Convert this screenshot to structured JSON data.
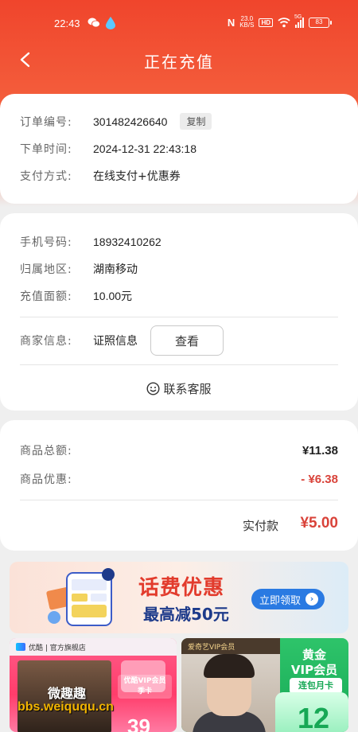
{
  "status_bar": {
    "time": "22:43",
    "network_speed_value": "23.0",
    "network_speed_unit": "KB/S",
    "hd": "HD",
    "signal": "5G",
    "battery": "83"
  },
  "nav": {
    "title": "正在充值"
  },
  "order": {
    "number_label": "订单编号:",
    "number_value": "301482426640",
    "copy_label": "复制",
    "time_label": "下单时间:",
    "time_value": "2024-12-31 22:43:18",
    "pay_method_label": "支付方式:",
    "pay_method_value": "在线支付+优惠券"
  },
  "recharge": {
    "phone_label": "手机号码:",
    "phone_value": "18932410262",
    "region_label": "归属地区:",
    "region_value": "湖南移动",
    "face_label": "充值面额:",
    "face_value": "10.00元",
    "merchant_label": "商家信息:",
    "merchant_value": "证照信息",
    "view_button": "查看",
    "service_label": "联系客服"
  },
  "summary": {
    "total_label": "商品总额:",
    "total_value": "¥11.38",
    "discount_label": "商品优惠:",
    "discount_value": "- ¥6.38",
    "paid_label": "实付款",
    "paid_value": "¥5.00"
  },
  "banner": {
    "title": "话费优惠",
    "subtitle": "最高减50元",
    "button": "立即领取"
  },
  "promo_left": {
    "brand": "优酷 | 官方旗舰店",
    "text_line1": "优酷VIP会员",
    "text_line2": "季卡",
    "number": "39"
  },
  "promo_right": {
    "tag": "爱奇艺VIP会员",
    "title_line1": "黄金",
    "title_line2": "VIP会员",
    "pill": "连包月卡",
    "number": "12"
  },
  "watermark": {
    "cn": "微趣趣",
    "url": "bbs.weiququ.cn"
  },
  "colors": {
    "brand_red": "#f0452c",
    "price_red": "#d9433a",
    "button_blue": "#2a7ae2"
  }
}
